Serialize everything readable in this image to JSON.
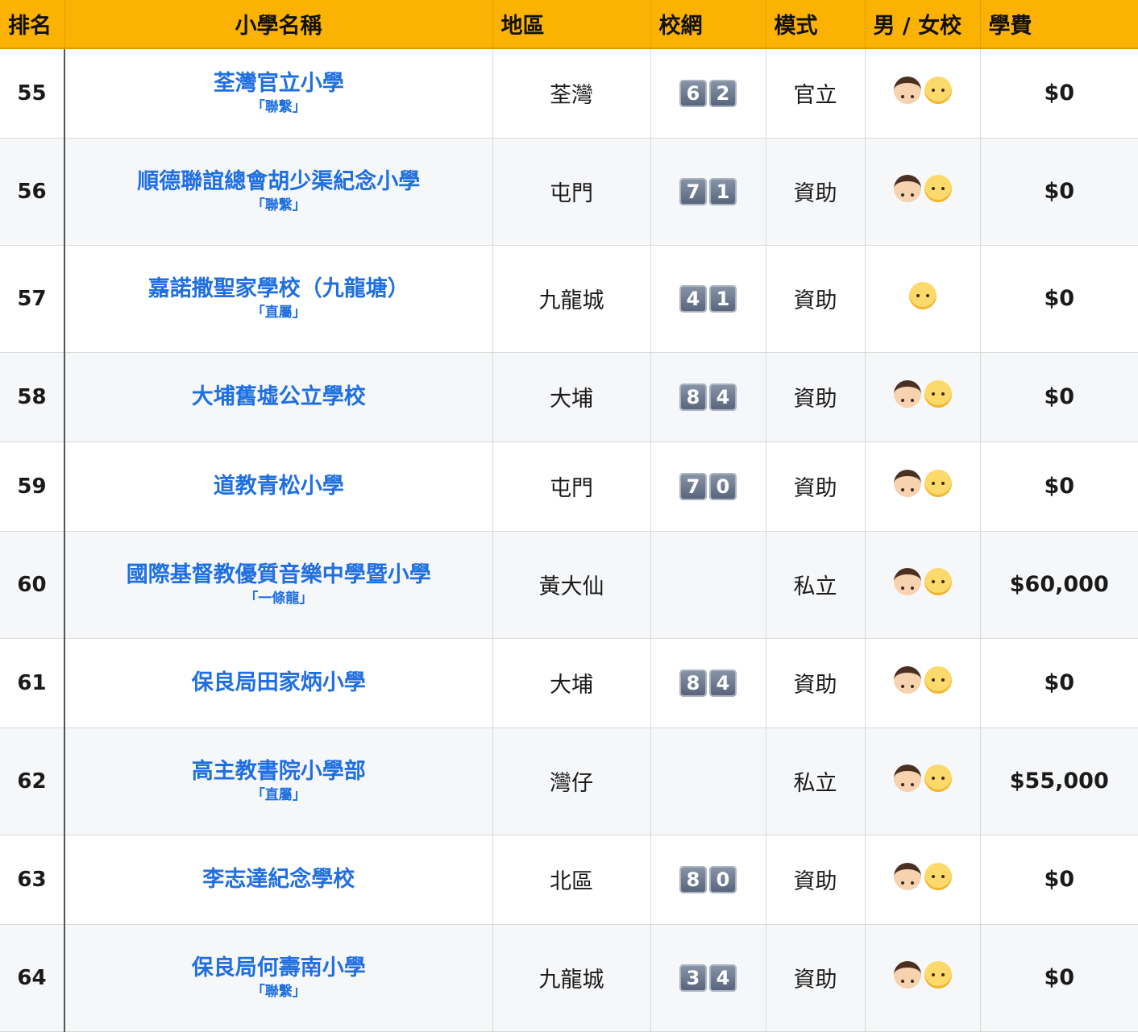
{
  "headers": {
    "rank": "排名",
    "name": "小學名稱",
    "district": "地區",
    "net": "校網",
    "mode": "模式",
    "gender": "男 / 女校",
    "fee": "學費"
  },
  "rows": [
    {
      "rank": "55",
      "name": "荃灣官立小學",
      "tag": "「聯繫」",
      "district": "荃灣",
      "net": [
        "6",
        "2"
      ],
      "mode": "官立",
      "gender": [
        "boy-icon",
        "girl-icon"
      ],
      "fee": "$0"
    },
    {
      "rank": "56",
      "name": "順德聯誼總會胡少渠紀念小學",
      "tag": "「聯繫」",
      "district": "屯門",
      "net": [
        "7",
        "1"
      ],
      "mode": "資助",
      "gender": [
        "boy-icon",
        "girl-icon"
      ],
      "fee": "$0"
    },
    {
      "rank": "57",
      "name": "嘉諾撒聖家學校（九龍塘）",
      "tag": "「直屬」",
      "district": "九龍城",
      "net": [
        "4",
        "1"
      ],
      "mode": "資助",
      "gender": [
        "girl-icon"
      ],
      "fee": "$0"
    },
    {
      "rank": "58",
      "name": "大埔舊墟公立學校",
      "tag": "",
      "district": "大埔",
      "net": [
        "8",
        "4"
      ],
      "mode": "資助",
      "gender": [
        "boy-icon",
        "girl-icon"
      ],
      "fee": "$0"
    },
    {
      "rank": "59",
      "name": "道教青松小學",
      "tag": "",
      "district": "屯門",
      "net": [
        "7",
        "0"
      ],
      "mode": "資助",
      "gender": [
        "boy-icon",
        "girl-icon"
      ],
      "fee": "$0"
    },
    {
      "rank": "60",
      "name": "國際基督教優質音樂中學暨小學",
      "tag": "「一條龍」",
      "district": "黃大仙",
      "net": [],
      "mode": "私立",
      "gender": [
        "boy-icon",
        "girl-icon"
      ],
      "fee": "$60,000"
    },
    {
      "rank": "61",
      "name": "保良局田家炳小學",
      "tag": "",
      "district": "大埔",
      "net": [
        "8",
        "4"
      ],
      "mode": "資助",
      "gender": [
        "boy-icon",
        "girl-icon"
      ],
      "fee": "$0"
    },
    {
      "rank": "62",
      "name": "高主教書院小學部",
      "tag": "「直屬」",
      "district": "灣仔",
      "net": [],
      "mode": "私立",
      "gender": [
        "boy-icon",
        "girl-icon"
      ],
      "fee": "$55,000"
    },
    {
      "rank": "63",
      "name": "李志達紀念學校",
      "tag": "",
      "district": "北區",
      "net": [
        "8",
        "0"
      ],
      "mode": "資助",
      "gender": [
        "boy-icon",
        "girl-icon"
      ],
      "fee": "$0"
    },
    {
      "rank": "64",
      "name": "保良局何壽南小學",
      "tag": "「聯繫」",
      "district": "九龍城",
      "net": [
        "3",
        "4"
      ],
      "mode": "資助",
      "gender": [
        "boy-icon",
        "girl-icon"
      ],
      "fee": "$0"
    }
  ]
}
